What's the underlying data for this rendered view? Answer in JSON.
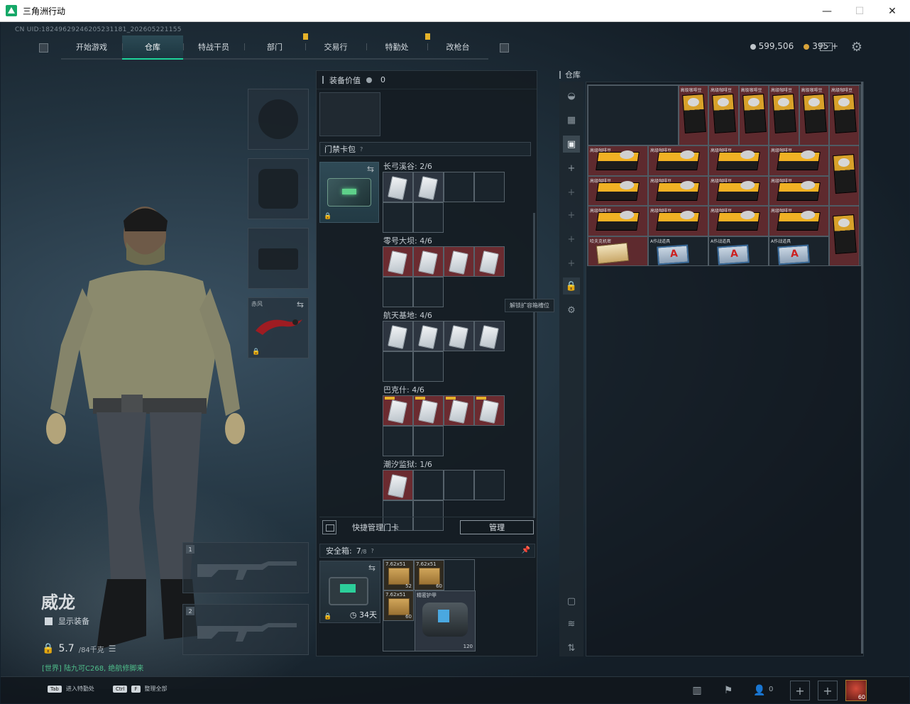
{
  "window": {
    "title": "三角洲行动",
    "minimize": "—",
    "maximize": "☐",
    "close": "✕"
  },
  "uid": "CN UID:18249629246205231181_202605221155",
  "nav": {
    "tabs": [
      {
        "label": "开始游戏",
        "active": false,
        "alert": false
      },
      {
        "label": "仓库",
        "active": true,
        "alert": false
      },
      {
        "label": "特战干员",
        "active": false,
        "alert": false
      },
      {
        "label": "部门",
        "active": false,
        "alert": true
      },
      {
        "label": "交易行",
        "active": false,
        "alert": false
      },
      {
        "label": "特勤处",
        "active": false,
        "alert": true
      },
      {
        "label": "改枪台",
        "active": false,
        "alert": false
      }
    ]
  },
  "currency": {
    "coins": "599,506",
    "tokens": "395",
    "add": "+"
  },
  "character": {
    "name": "威龙",
    "show_equipment": "显示装备",
    "weight": "5.7",
    "weight_max": "/84千克",
    "message": "[世界] 陆九可C268, 绝航修脚来"
  },
  "equipment": {
    "melee_label": "赤风",
    "weapon1_num": "1",
    "weapon2_num": "2"
  },
  "middle": {
    "equipment_value_label": "装备价值",
    "equipment_value": "0",
    "keywallet_label": "门禁卡包",
    "help": "?",
    "maps": [
      {
        "label": "长弓溪谷: 2/6"
      },
      {
        "label": "零号大坝: 4/6"
      },
      {
        "label": "航天基地: 4/6"
      },
      {
        "label": "巴克什: 4/6"
      },
      {
        "label": "潮汐监狱: 1/6"
      }
    ],
    "tooltip": "解锁扩容箱槽位",
    "quick_manage_label": "快捷管理门卡",
    "manage_button": "管理",
    "safe_box_label": "安全箱:",
    "safe_box_count": "7",
    "safe_box_total": "/8",
    "safe_box_days": "34天",
    "ammo": [
      {
        "name": "7.62x51",
        "qty": "52"
      },
      {
        "name": "7.62x51",
        "qty": "60"
      },
      {
        "name": "7.62x51",
        "qty": "60"
      }
    ],
    "armor": {
      "name": "精密护甲",
      "qty": "120"
    }
  },
  "stash": {
    "title": "仓库",
    "coffee_label": "高级咖啡豆",
    "crate_label": "高级咖啡豆",
    "doc_label": "哈夫克机密",
    "intel_label": "A作战道具"
  },
  "bottom": {
    "hint1_key": "Tab",
    "hint1_text": "进入特勤处",
    "hint2_key1": "Ctrl",
    "hint2_key2": "F",
    "hint2_text": "整理全部",
    "friends": "0",
    "avatar_level": "60"
  },
  "colors": {
    "accent": "#1ed39a",
    "alert": "#e6b229",
    "red_cell": "#6b2b30"
  }
}
